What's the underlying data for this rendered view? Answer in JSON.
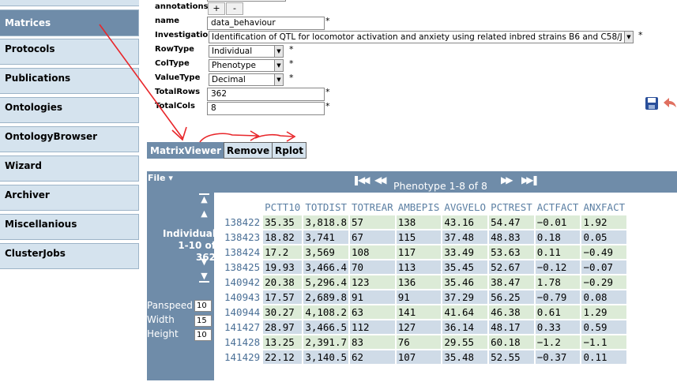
{
  "sidebar": {
    "items": [
      {
        "label": "Matrices",
        "active": true
      },
      {
        "label": "Protocols"
      },
      {
        "label": "Publications"
      },
      {
        "label": "Ontologies"
      },
      {
        "label": "OntologyBrowser"
      },
      {
        "label": "Wizard"
      },
      {
        "label": "Archiver"
      },
      {
        "label": "Miscellanious"
      },
      {
        "label": "ClusterJobs"
      }
    ]
  },
  "form": {
    "annotations_label": "annotations",
    "add_label": "+",
    "remove_label": "-",
    "name_label": "name",
    "name_value": "data_behaviour",
    "investigation_label": "Investigation",
    "investigation_value": "Identification of QTL for locomotor activation and anxiety using related inbred strains B6 and C58/J",
    "rowtype_label": "RowType",
    "rowtype_value": "Individual",
    "coltype_label": "ColType",
    "coltype_value": "Phenotype",
    "valuetype_label": "ValueType",
    "valuetype_value": "Decimal",
    "totalrows_label": "TotalRows",
    "totalrows_value": "362",
    "totalcols_label": "TotalCols",
    "totalcols_value": "8",
    "required_mark": "*"
  },
  "tabs": {
    "matrixviewer": "MatrixViewer",
    "remove": "Remove",
    "rplot": "Rplot"
  },
  "matrix": {
    "file_menu": "File ▾",
    "col_title": "Phenotype 1-8 of 8",
    "row_title_1": "Individual",
    "row_title_2": "1-10 of 362",
    "panspeed_label": "Panspeed",
    "panspeed_value": "10",
    "width_label": "Width",
    "width_value": "15",
    "height_label": "Height",
    "height_value": "10",
    "columns": [
      "PCTT10",
      "TOTDIST",
      "TOTREAR",
      "AMBEPIS",
      "AVGVELO",
      "PCTREST",
      "ACTFACT",
      "ANXFACT"
    ],
    "rows": [
      {
        "id": "138422",
        "values": [
          "35.35",
          "3,818.8",
          "57",
          "138",
          "43.16",
          "54.47",
          "-0.01",
          "1.92"
        ]
      },
      {
        "id": "138423",
        "values": [
          "18.82",
          "3,741",
          "67",
          "115",
          "37.48",
          "48.83",
          "0.18",
          "0.05"
        ]
      },
      {
        "id": "138424",
        "values": [
          "17.2",
          "3,569",
          "108",
          "117",
          "33.49",
          "53.63",
          "0.11",
          "-0.49"
        ]
      },
      {
        "id": "138425",
        "values": [
          "19.93",
          "3,466.4",
          "70",
          "113",
          "35.45",
          "52.67",
          "-0.12",
          "-0.07"
        ]
      },
      {
        "id": "140942",
        "values": [
          "20.38",
          "5,296.4",
          "123",
          "136",
          "35.46",
          "38.47",
          "1.78",
          "-0.29"
        ]
      },
      {
        "id": "140943",
        "values": [
          "17.57",
          "2,689.8",
          "91",
          "91",
          "37.29",
          "56.25",
          "-0.79",
          "0.08"
        ]
      },
      {
        "id": "140944",
        "values": [
          "30.27",
          "4,108.2",
          "63",
          "141",
          "41.64",
          "46.38",
          "0.61",
          "1.29"
        ]
      },
      {
        "id": "141427",
        "values": [
          "28.97",
          "3,466.5",
          "112",
          "127",
          "36.14",
          "48.17",
          "0.33",
          "0.59"
        ]
      },
      {
        "id": "141428",
        "values": [
          "13.25",
          "2,391.7",
          "83",
          "76",
          "29.55",
          "60.18",
          "-1.2",
          "-1.1"
        ]
      },
      {
        "id": "141429",
        "values": [
          "22.12",
          "3,140.5",
          "62",
          "107",
          "35.48",
          "52.55",
          "-0.37",
          "0.11"
        ]
      }
    ]
  },
  "colors": {
    "panel": "#6f8ca9",
    "sidebar": "#d5e3ee",
    "row_green": "#dcebd7",
    "row_blue": "#cfdbe7",
    "arrow": "#e8262a"
  }
}
